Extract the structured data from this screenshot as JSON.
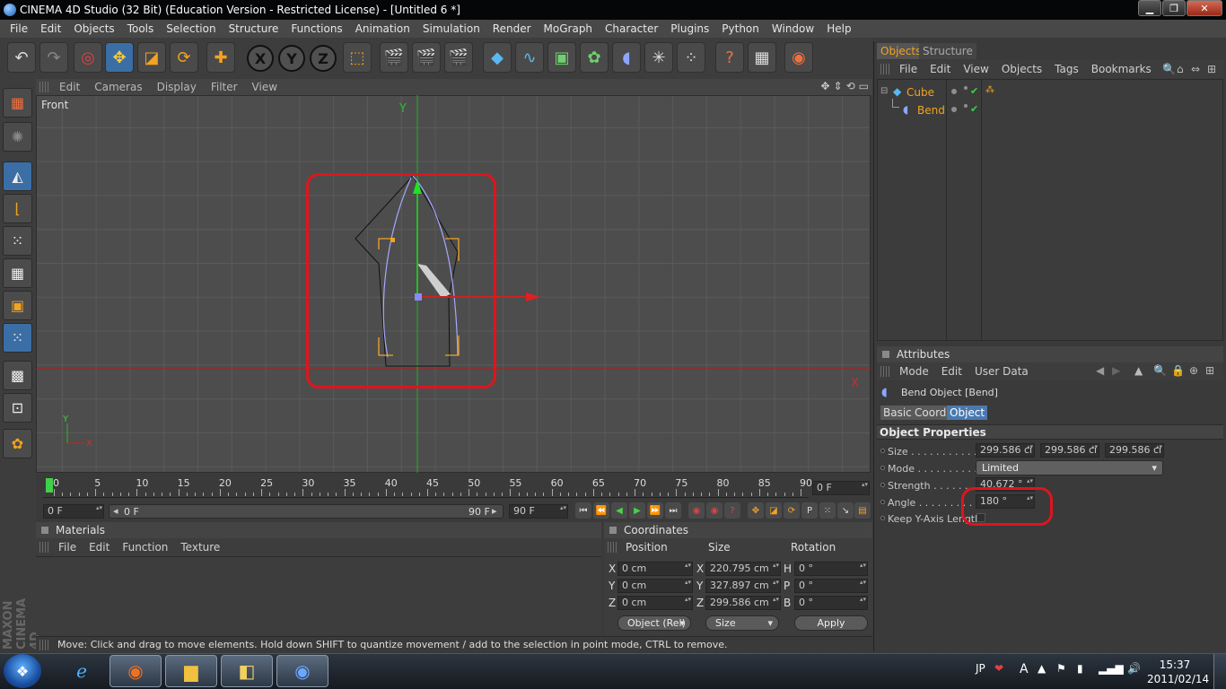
{
  "window": {
    "title": "CINEMA 4D Studio (32 Bit) (Education Version - Restricted License) - [Untitled 6 *]"
  },
  "menubar": [
    "File",
    "Edit",
    "Objects",
    "Tools",
    "Selection",
    "Structure",
    "Functions",
    "Animation",
    "Simulation",
    "Render",
    "MoGraph",
    "Character",
    "Plugins",
    "Python",
    "Window",
    "Help"
  ],
  "toolbar_axes": [
    "X",
    "Y",
    "Z"
  ],
  "viewport": {
    "menu": [
      "Edit",
      "Cameras",
      "Display",
      "Filter",
      "View"
    ],
    "name": "Front",
    "axis_y": "Y",
    "axis_x": "X",
    "mini_y": "Y",
    "mini_x": "X"
  },
  "timeline": {
    "ticks": [
      "0",
      "5",
      "10",
      "15",
      "20",
      "25",
      "30",
      "35",
      "40",
      "45",
      "50",
      "55",
      "60",
      "65",
      "70",
      "75",
      "80",
      "85",
      "90"
    ],
    "current_frame": "0 F",
    "start_frame": "0 F",
    "range_start": "0 F",
    "range_end": "90 F",
    "end_frame": "90 F"
  },
  "materials": {
    "header": "Materials",
    "menu": [
      "File",
      "Edit",
      "Function",
      "Texture"
    ]
  },
  "coordinates": {
    "header": "Coordinates",
    "col_position": "Position",
    "col_size": "Size",
    "col_rotation": "Rotation",
    "rows": [
      {
        "axis": "X",
        "pos": "0 cm",
        "size_axis": "X",
        "size": "220.795 cm",
        "rot_axis": "H",
        "rot": "0 °"
      },
      {
        "axis": "Y",
        "pos": "0 cm",
        "size_axis": "Y",
        "size": "327.897 cm",
        "rot_axis": "P",
        "rot": "0 °"
      },
      {
        "axis": "Z",
        "pos": "0 cm",
        "size_axis": "Z",
        "size": "299.586 cm",
        "rot_axis": "B",
        "rot": "0 °"
      }
    ],
    "mode": "Object (Rel)",
    "size_mode": "Size",
    "apply": "Apply"
  },
  "status": "Move: Click and drag to move elements. Hold down SHIFT to quantize movement / add to the selection in point mode, CTRL to remove.",
  "objects_panel": {
    "tabs": [
      "Objects",
      "Structure"
    ],
    "menu": [
      "File",
      "Edit",
      "View",
      "Objects",
      "Tags",
      "Bookmarks"
    ],
    "items": [
      {
        "name": "Cube"
      },
      {
        "name": "Bend"
      }
    ]
  },
  "attributes": {
    "header": "Attributes",
    "menu": [
      "Mode",
      "Edit",
      "User Data"
    ],
    "object_title": "Bend Object [Bend]",
    "tabs": [
      "Basic",
      "Coord.",
      "Object"
    ],
    "section": "Object Properties",
    "size_label": "Size . . . . . . . . . . . . .",
    "size_values": [
      "299.586 cı",
      "299.586 cı",
      "299.586 cı"
    ],
    "mode_label": "Mode . . . . . . . . . . . .",
    "mode_value": "Limited",
    "strength_label": "Strength . . . . . . . . .",
    "strength_value": "40.672 °",
    "angle_label": "Angle . . . . . . . . . . .",
    "angle_value": "180 °",
    "keep_label": "Keep Y-Axis Length"
  },
  "taskbar": {
    "lang": "JP",
    "time": "15:37",
    "date": "2011/02/14",
    "ime": "A"
  },
  "branding": {
    "vertical": "MAXON CINEMA 4D"
  },
  "colors": {
    "accent_orange": "#f2a322",
    "highlight_red": "#e0141d",
    "selection_blue": "#4a79b0"
  }
}
